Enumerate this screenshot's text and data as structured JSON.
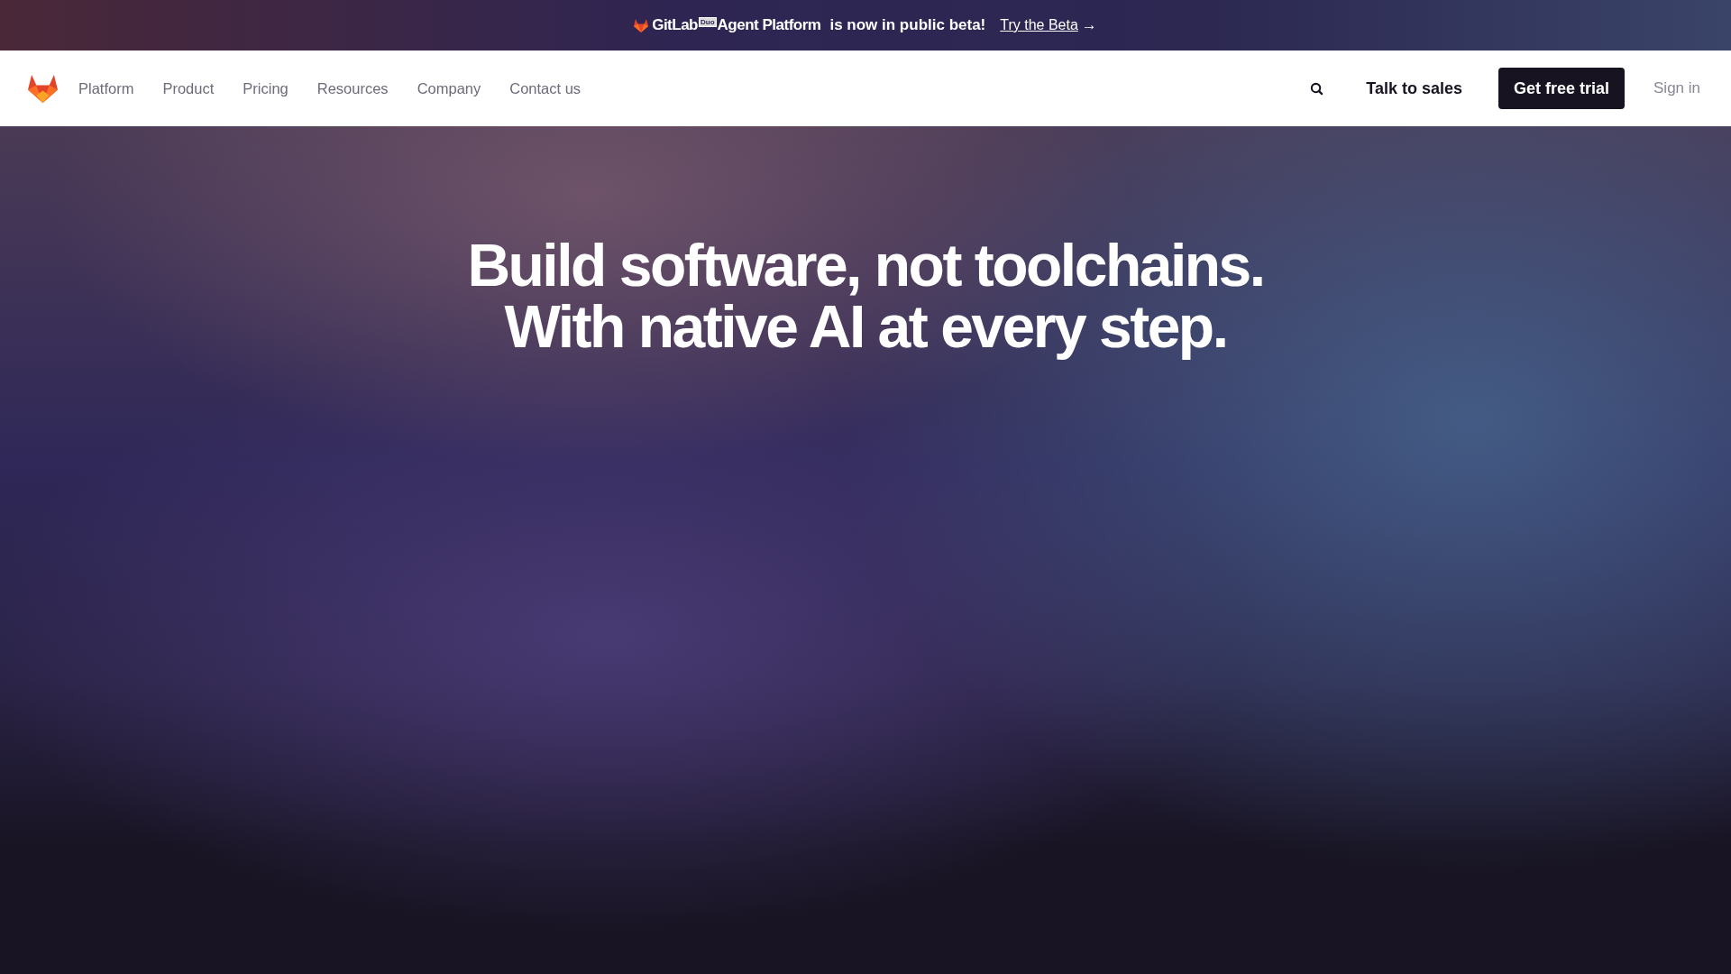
{
  "banner": {
    "brand": "GitLab",
    "badge": "Duo",
    "product": "Agent Platform",
    "message": "is now in public beta!",
    "link": "Try the Beta",
    "link_arrow": "→"
  },
  "nav": {
    "items": [
      "Platform",
      "Product",
      "Pricing",
      "Resources",
      "Company",
      "Contact us"
    ],
    "talk": "Talk to sales",
    "trial": "Get free trial",
    "signin": "Sign in"
  },
  "hero": {
    "lines": [
      "Build software, not toolchains.",
      "With native AI at every step."
    ]
  }
}
